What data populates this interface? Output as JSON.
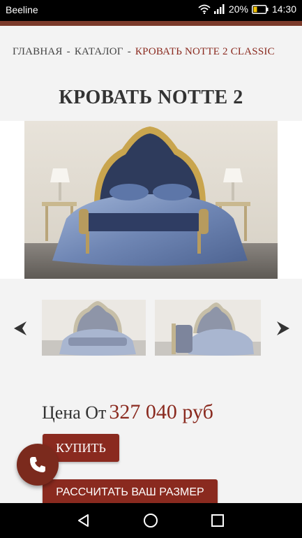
{
  "status_bar": {
    "carrier": "Beeline",
    "battery": "20%",
    "time": "14:30",
    "icons": [
      "wifi-icon",
      "signal-icon",
      "battery-icon"
    ]
  },
  "colors": {
    "accent": "#8a2a1f",
    "accent_dark": "#7b2a1d",
    "background": "#f3f3f3"
  },
  "breadcrumb": {
    "home": "ГЛАВНАЯ",
    "catalog": "КАТАЛОГ",
    "separator": "-",
    "current": "КРОВАТЬ NOTTE 2 CLASSIC"
  },
  "page_title": "КРОВАТЬ NOTTE 2",
  "gallery": {
    "main_image": "bed-photo",
    "thumbnails": [
      "bed-thumbnail-front",
      "bed-thumbnail-side"
    ],
    "prev_icon": "arrow-left-icon",
    "next_icon": "arrow-right-icon"
  },
  "price": {
    "label": "Цена От",
    "value": "327 040 руб"
  },
  "buttons": {
    "buy": "КУПИТЬ",
    "calculate": "РАССЧИТАТЬ ВАШ РАЗМЕР"
  },
  "fab": {
    "icon": "phone-icon"
  },
  "nav_bar": {
    "icons": [
      "back-icon",
      "home-icon",
      "recent-apps-icon"
    ]
  }
}
